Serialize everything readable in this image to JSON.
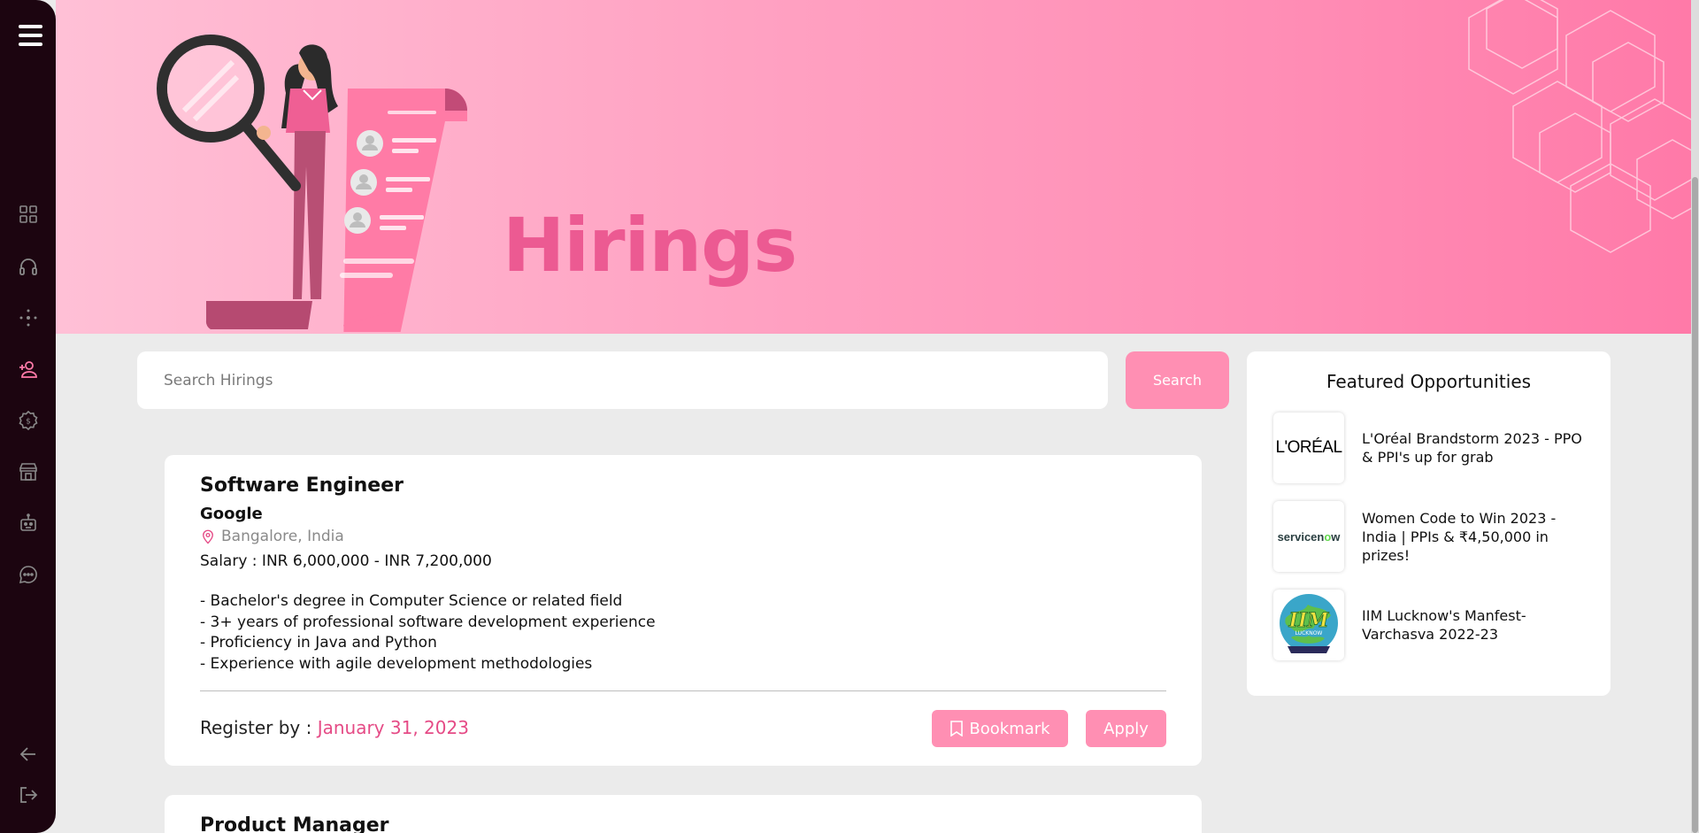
{
  "sidebar": {
    "menu_icon": "hamburger-menu-icon",
    "items": [
      {
        "icon": "dashboard-grid-icon"
      },
      {
        "icon": "headphones-icon"
      },
      {
        "icon": "network-dots-icon"
      },
      {
        "icon": "add-user-icon",
        "active": true
      },
      {
        "icon": "currency-settings-icon"
      },
      {
        "icon": "storefront-icon"
      },
      {
        "icon": "robot-icon"
      },
      {
        "icon": "chat-bubble-icon"
      }
    ],
    "bottom": [
      {
        "icon": "arrow-left-icon"
      },
      {
        "icon": "logout-icon"
      }
    ]
  },
  "banner": {
    "title": "Hirings"
  },
  "search": {
    "placeholder": "Search Hirings",
    "button_label": "Search"
  },
  "jobs": [
    {
      "title": "Software Engineer",
      "company": "Google",
      "location": "Bangalore, India",
      "salary": "Salary : INR 6,000,000 - INR 7,200,000",
      "requirements": [
        "- Bachelor's degree in Computer Science or related field",
        "- 3+ years of professional software development experience",
        "- Proficiency in Java and Python",
        "- Experience with agile development methodologies"
      ],
      "register_label": "Register by :",
      "register_date": "January 31, 2023",
      "bookmark_label": "Bookmark",
      "apply_label": "Apply"
    },
    {
      "title": "Product Manager"
    }
  ],
  "featured": {
    "title": "Featured Opportunities",
    "items": [
      {
        "logo_text": "L'ORÉAL",
        "text": "L'Oréal Brandstorm 2023 - PPO & PPI's up for grab"
      },
      {
        "logo_text_a": "servicen",
        "logo_text_b": "o",
        "logo_text_c": "w",
        "text": "Women Code to Win 2023 - India | PPIs & ₹4,50,000 in prizes!"
      },
      {
        "logo_text": "IIM",
        "logo_subtext": "LUCKNOW",
        "text": "IIM Lucknow's Manfest-Varchasva 2022-23"
      }
    ]
  },
  "colors": {
    "sidebar_bg": "#1c0510",
    "accent": "#ff8fb3",
    "accent_dark": "#e54b86",
    "banner_title": "#ec5a92",
    "page_bg": "#ebebeb"
  }
}
